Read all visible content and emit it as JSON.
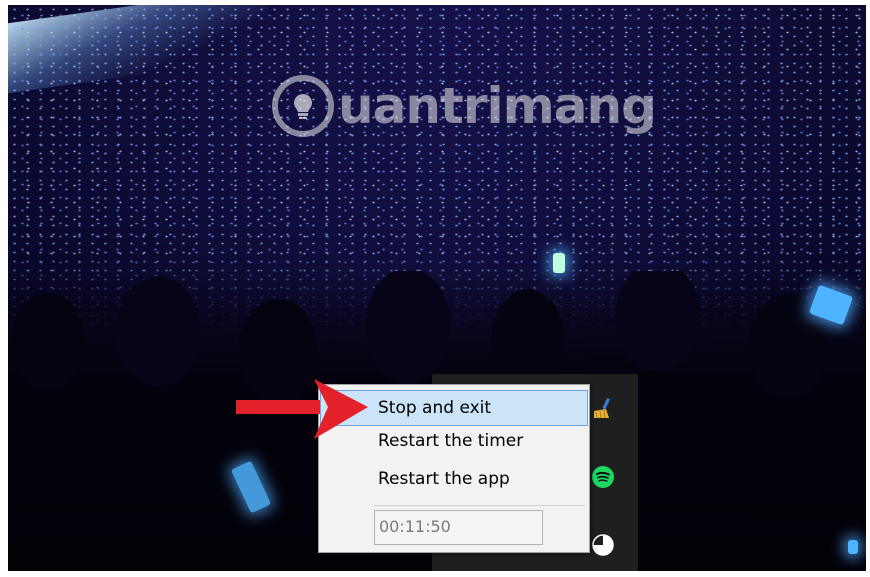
{
  "watermark": {
    "text": "uantrimang",
    "logo_icon": "lightbulb-icon"
  },
  "tray_icons": [
    "broom-icon",
    "spotify-icon",
    "pie-timer-icon"
  ],
  "context_menu": {
    "items": [
      {
        "label": "Stop and exit",
        "highlighted": true
      },
      {
        "label": "Restart the timer",
        "highlighted": false
      },
      {
        "label": "Restart the app",
        "highlighted": false
      }
    ],
    "timer_value": "00:11:50"
  },
  "annotation": {
    "type": "arrow",
    "color": "#e3212b",
    "points_to": "Stop and exit"
  },
  "colors": {
    "menu_highlight": "#cce4f7",
    "menu_highlight_border": "#69a5de",
    "tray_bg": "#1f1f1f",
    "spotify_green": "#1ed760"
  }
}
